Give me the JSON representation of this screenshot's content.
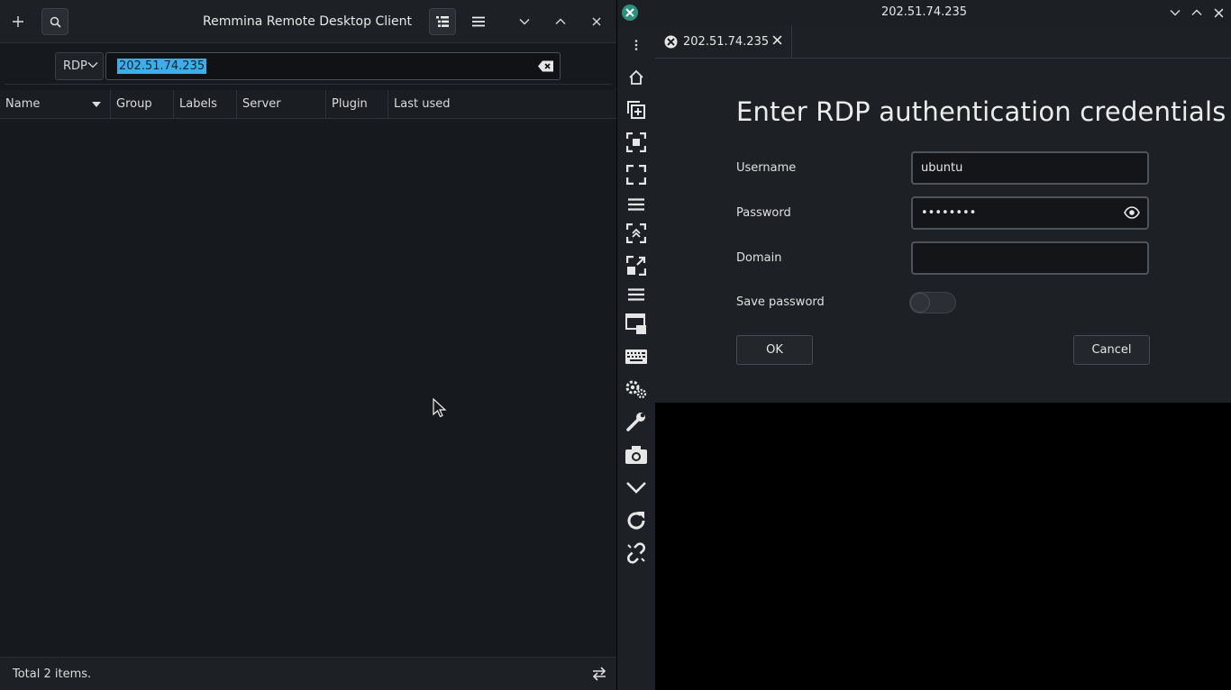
{
  "main_window": {
    "title": "Remmina Remote Desktop Client",
    "header_icons": [
      "add-icon",
      "search-icon",
      "list-view-icon",
      "menu-icon",
      "minimize-icon",
      "maximize-icon",
      "close-icon"
    ],
    "quick_connect": {
      "protocol": "RDP",
      "server_value": "202.51.74.235"
    },
    "columns": [
      "Name",
      "Group",
      "Labels",
      "Server",
      "Plugin",
      "Last used"
    ],
    "status_text": "Total 2 items."
  },
  "connection_window": {
    "title": "202.51.74.235",
    "tab_label": "202.51.74.235",
    "auth": {
      "heading": "Enter RDP authentication credentials",
      "username_label": "Username",
      "username_value": "ubuntu",
      "password_label": "Password",
      "password_value": "••••••••",
      "domain_label": "Domain",
      "domain_value": "",
      "save_password_label": "Save password",
      "save_password_on": false,
      "ok_label": "OK",
      "cancel_label": "Cancel"
    },
    "toolbar_icons": [
      "home-icon",
      "duplicate-icon",
      "fit-window-icon",
      "fullscreen-icon",
      "menu-icon",
      "dynamic-resolution-icon",
      "scaled-icon",
      "menu-icon",
      "multi-monitor-icon",
      "keyboard-icon",
      "preferences-icon",
      "tools-icon",
      "screenshot-icon",
      "minimize-icon",
      "reconnect-icon",
      "disconnect-icon"
    ]
  },
  "colors": {
    "accent": "#3daee9",
    "window_bg": "#1d2024",
    "list_bg": "#16191d"
  }
}
